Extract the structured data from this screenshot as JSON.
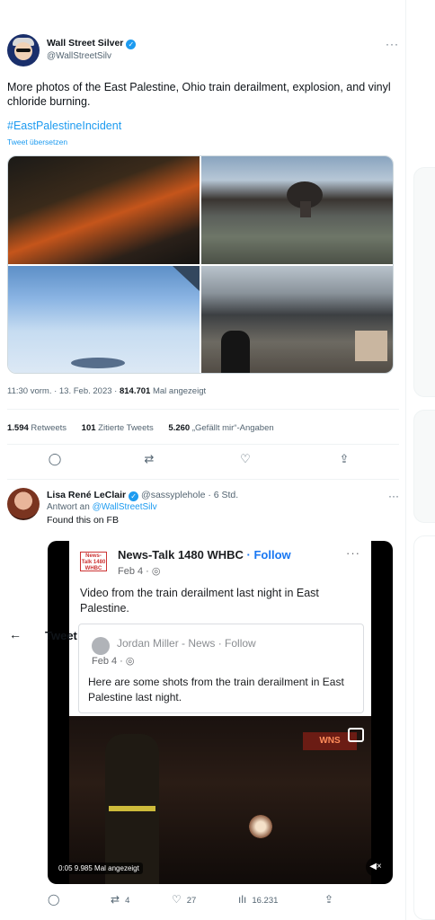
{
  "main_tweet": {
    "name": "Wall Street Silver",
    "handle": "@WallStreetSilv",
    "text": "More photos of the East Palestine, Ohio train derailment, explosion, and vinyl chloride burning.",
    "hashtag": "#EastPalestineIncident",
    "translate_label": "Tweet übersetzen",
    "time": "11:30 vorm. · 13. Feb. 2023 · ",
    "views_count": "814.701",
    "views_label": " Mal angezeigt",
    "stats": {
      "retweets_count": "1.594",
      "retweets_label": " Retweets",
      "quotes_count": "101",
      "quotes_label": " Zitierte Tweets",
      "likes_count": "5.260",
      "likes_label": " „Gefällt mir“-Angaben"
    }
  },
  "reply": {
    "name": "Lisa René LeClair",
    "handle_time": " @sassyplehole · 6 Std.",
    "reply_to_prefix": "Antwort an ",
    "reply_to_handle": "@WallStreetSilv",
    "text": "Found this on FB",
    "video": {
      "fb_logo": "News-Talk 1480 WHBC",
      "page": "News-Talk 1480 WHBC",
      "follow": " · Follow",
      "date": "Feb 4 · ◎",
      "text": "Video from the train derailment last night in East Palestine.",
      "inner_page": "Jordan Miller - News · Follow",
      "inner_date": "Feb 4 · ◎",
      "inner_text": "Here are some shots from the train derailment in East Palestine last night.",
      "sign_text": "WNS",
      "badge": "0:05  9.985 Mal angezeigt"
    },
    "actions": {
      "retweets": "4",
      "likes": "27",
      "views": "16.231"
    }
  },
  "header": {
    "back_icon": "←",
    "title": "Tweet"
  },
  "icons": {
    "more": "···",
    "reply": "◯",
    "retweet": "⇄",
    "like": "♡",
    "share": "⇪",
    "views": "ılı",
    "mute": "◀×",
    "verified": "✓"
  }
}
